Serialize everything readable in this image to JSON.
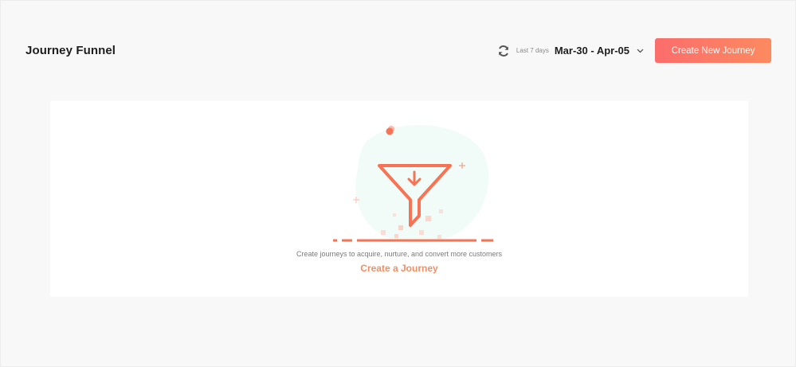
{
  "header": {
    "title": "Journey Funnel",
    "range_caption": "Last 7 days",
    "date_range": "Mar-30 - Apr-05",
    "create_button_label": "Create New Journey"
  },
  "empty_state": {
    "message": "Create journeys to acquire, nurture, and convert more customers",
    "link_label": "Create a Journey",
    "illustration_icon": "funnel-icon"
  },
  "icons": {
    "refresh": "refresh-icon",
    "dropdown": "chevron-down-icon"
  },
  "colors": {
    "background": "#f8f8f8",
    "card": "#ffffff",
    "accent": "#f77354",
    "button_gradient_start": "#fb6d6b",
    "button_gradient_end": "#fc8a5f",
    "link": "#f98c5f",
    "blob": "#f1fcf8"
  }
}
